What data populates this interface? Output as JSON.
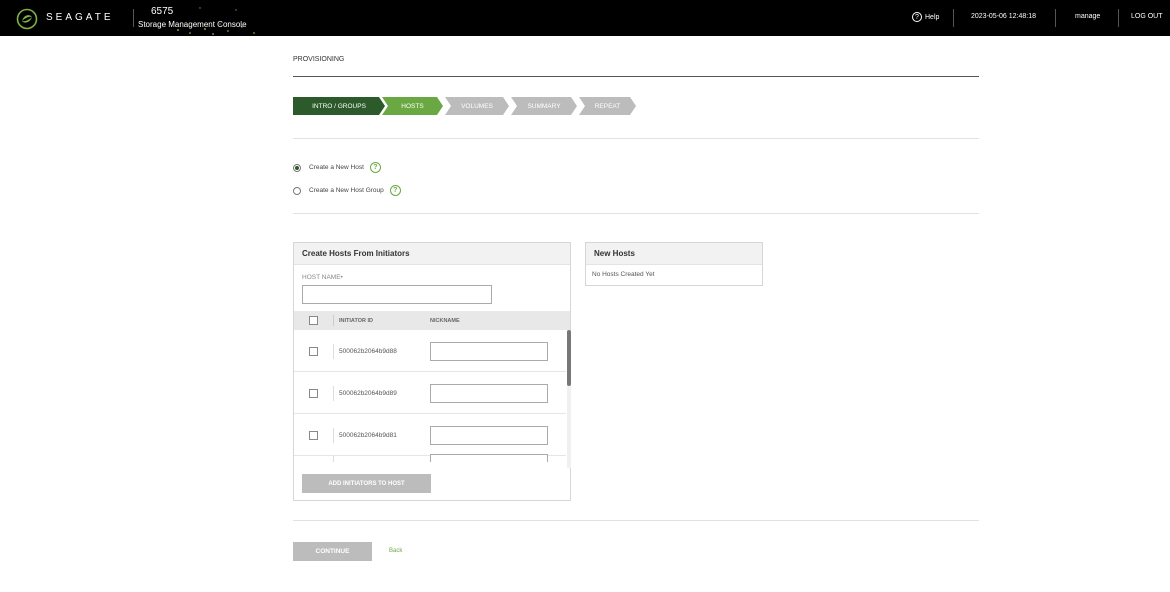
{
  "header": {
    "brand": "SEAGATE",
    "system_name": "6575",
    "system_subtitle": "Storage Management Console",
    "help_label": "Help",
    "datetime": "2023-05-06 12:48:18",
    "user": "manage",
    "logout_label": "LOG OUT"
  },
  "page": {
    "title": "PROVISIONING"
  },
  "wizard": {
    "steps": [
      {
        "label": "INTRO / GROUPS",
        "state": "done"
      },
      {
        "label": "HOSTS",
        "state": "active"
      },
      {
        "label": "VOLUMES",
        "state": "pending"
      },
      {
        "label": "SUMMARY",
        "state": "pending"
      },
      {
        "label": "REPEAT",
        "state": "pending"
      }
    ]
  },
  "options": {
    "new_host": {
      "label": "Create a New Host",
      "selected": true
    },
    "new_host_group": {
      "label": "Create a New Host Group",
      "selected": false
    },
    "help_glyph": "?"
  },
  "create_panel": {
    "title": "Create Hosts From Initiators",
    "host_name_label": "HOST NAME•",
    "host_name_value": "",
    "columns": {
      "initiator_id": "INITIATOR ID",
      "nickname": "NICKNAME"
    },
    "rows": [
      {
        "initiator_id": "500062b2064b9d88",
        "nickname": ""
      },
      {
        "initiator_id": "500062b2064b9d89",
        "nickname": ""
      },
      {
        "initiator_id": "500062b2064b9d81",
        "nickname": ""
      }
    ],
    "add_button": "ADD INITIATORS TO HOST"
  },
  "new_hosts_panel": {
    "title": "New Hosts",
    "empty_message": "No Hosts Created Yet"
  },
  "footer": {
    "continue_label": "CONTINUE",
    "back_label": "Back"
  },
  "colors": {
    "step_done": "#2d5a2a",
    "step_active": "#6aa843",
    "step_pending": "#bcbcbc",
    "accent": "#6aa843"
  }
}
